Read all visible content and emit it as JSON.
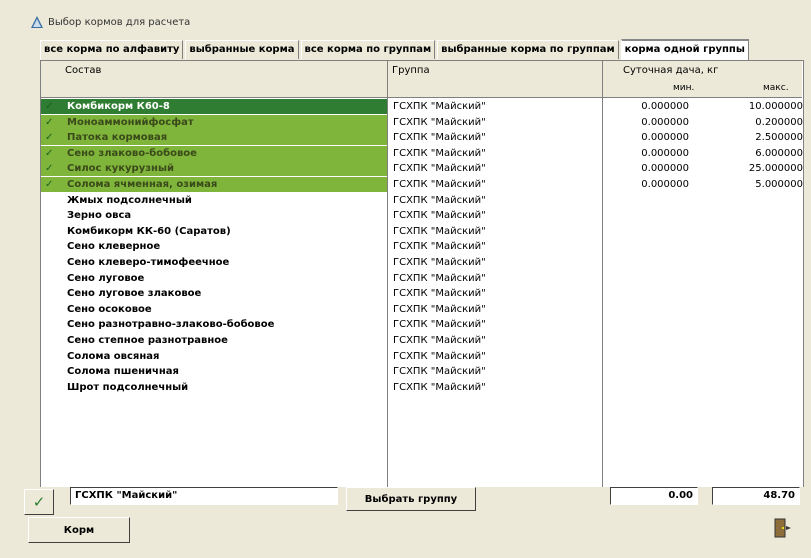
{
  "window": {
    "title": "Выбор кормов для расчета"
  },
  "tabs": [
    {
      "label": "все корма по алфавиту"
    },
    {
      "label": "выбранные корма"
    },
    {
      "label": "все корма по группам"
    },
    {
      "label": "выбранные корма по группам"
    },
    {
      "label": "корма одной группы"
    }
  ],
  "table": {
    "headers": {
      "composition": "Состав",
      "group": "Группа",
      "daily": "Суточная дача, кг",
      "min": "мин.",
      "max": "макс."
    },
    "rows": [
      {
        "name": "Комбикорм К60-8",
        "group": "ГСХПК \"Майский\"",
        "min": "0.000000",
        "max": "10.000000",
        "selected": true
      },
      {
        "name": "Моноаммонийфосфат",
        "group": "ГСХПК \"Майский\"",
        "min": "0.000000",
        "max": "0.200000",
        "selected": true
      },
      {
        "name": "Патока кормовая",
        "group": "ГСХПК \"Майский\"",
        "min": "0.000000",
        "max": "2.500000",
        "selected": true
      },
      {
        "name": "Сено злаково-бобовое",
        "group": "ГСХПК \"Майский\"",
        "min": "0.000000",
        "max": "6.000000",
        "selected": true
      },
      {
        "name": "Силос кукурузный",
        "group": "ГСХПК \"Майский\"",
        "min": "0.000000",
        "max": "25.000000",
        "selected": true
      },
      {
        "name": "Солома ячменная, озимая",
        "group": "ГСХПК \"Майский\"",
        "min": "0.000000",
        "max": "5.000000",
        "selected": true
      },
      {
        "name": "Жмых подсолнечный",
        "group": "ГСХПК \"Майский\"",
        "min": "",
        "max": "",
        "selected": false
      },
      {
        "name": "Зерно овса",
        "group": "ГСХПК \"Майский\"",
        "min": "",
        "max": "",
        "selected": false
      },
      {
        "name": "Комбикорм КК-60 (Саратов)",
        "group": "ГСХПК \"Майский\"",
        "min": "",
        "max": "",
        "selected": false
      },
      {
        "name": "Сено клеверное",
        "group": "ГСХПК \"Майский\"",
        "min": "",
        "max": "",
        "selected": false
      },
      {
        "name": "Сено клеверо-тимофеечное",
        "group": "ГСХПК \"Майский\"",
        "min": "",
        "max": "",
        "selected": false
      },
      {
        "name": "Сено луговое",
        "group": "ГСХПК \"Майский\"",
        "min": "",
        "max": "",
        "selected": false
      },
      {
        "name": "Сено луговое злаковое",
        "group": "ГСХПК \"Майский\"",
        "min": "",
        "max": "",
        "selected": false
      },
      {
        "name": "Сено осоковое",
        "group": "ГСХПК \"Майский\"",
        "min": "",
        "max": "",
        "selected": false
      },
      {
        "name": "Сено разнотравно-злаково-бобовое",
        "group": "ГСХПК \"Майский\"",
        "min": "",
        "max": "",
        "selected": false
      },
      {
        "name": "Сено степное разнотравное",
        "group": "ГСХПК \"Майский\"",
        "min": "",
        "max": "",
        "selected": false
      },
      {
        "name": "Солома овсяная",
        "group": "ГСХПК \"Майский\"",
        "min": "",
        "max": "",
        "selected": false
      },
      {
        "name": "Солома пшеничная",
        "group": "ГСХПК \"Майский\"",
        "min": "",
        "max": "",
        "selected": false
      },
      {
        "name": "Шрот подсолнечный",
        "group": "ГСХПК \"Майский\"",
        "min": "",
        "max": "",
        "selected": false
      }
    ]
  },
  "bottom": {
    "group_value": "ГСХПК \"Майский\"",
    "choose_group": "Выбрать группу",
    "total_min": "0.00",
    "total_max": "48.70",
    "feed_button": "Корм"
  },
  "colors": {
    "selected_row": "#7fb53a",
    "active_row": "#2e7d32"
  }
}
